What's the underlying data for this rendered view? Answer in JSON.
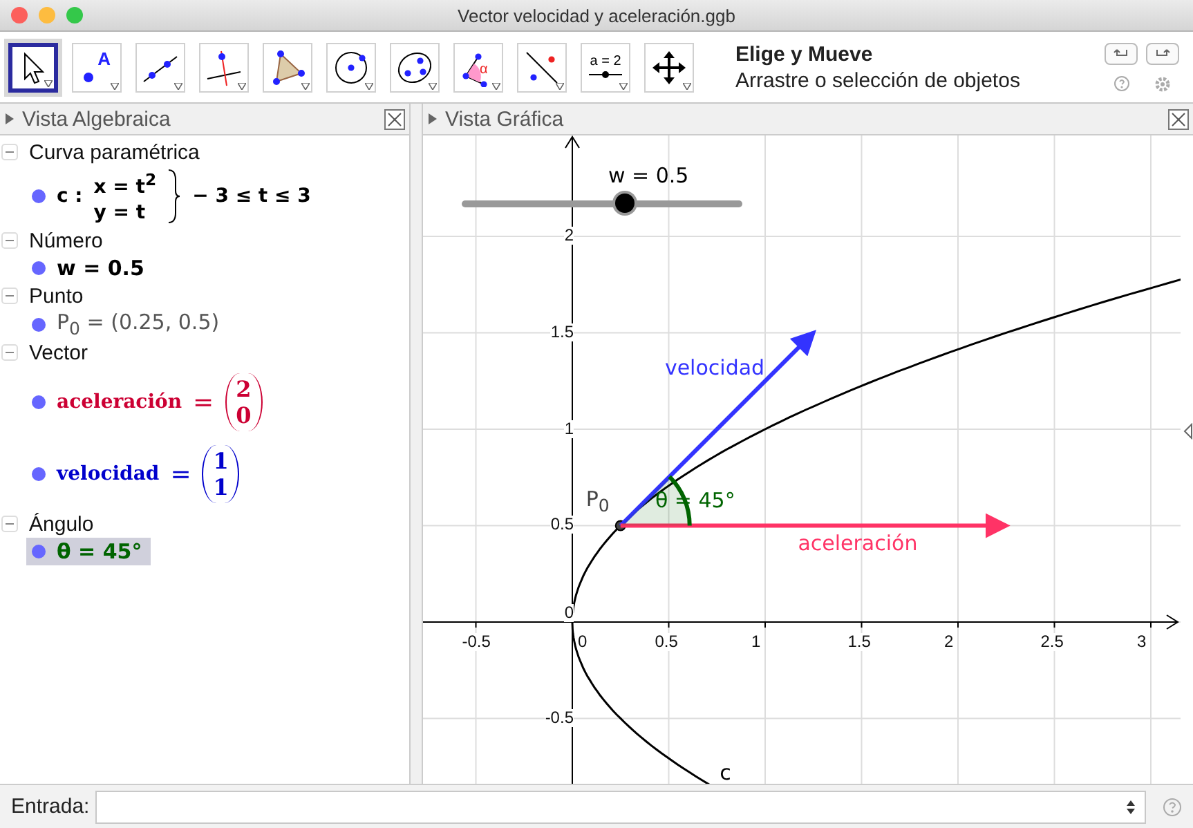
{
  "window": {
    "title": "Vector velocidad y aceleración.ggb"
  },
  "toolbar": {
    "tools": [
      {
        "kind": "move",
        "selected": true
      },
      {
        "kind": "point",
        "selected": false,
        "glyph": "A"
      },
      {
        "kind": "line",
        "selected": false
      },
      {
        "kind": "perpendicular",
        "selected": false
      },
      {
        "kind": "polygon",
        "selected": false
      },
      {
        "kind": "circle",
        "selected": false
      },
      {
        "kind": "conic",
        "selected": false
      },
      {
        "kind": "angle",
        "selected": false,
        "glyph": "α"
      },
      {
        "kind": "reflect",
        "selected": false
      },
      {
        "kind": "slider",
        "selected": false,
        "glyph": "a = 2"
      },
      {
        "kind": "move_view",
        "selected": false
      }
    ],
    "tool_name": "Elige y Mueve",
    "tool_help": "Arrastre o selección de objetos"
  },
  "algebra_view": {
    "title": "Vista Algebraica",
    "categories": [
      {
        "name": "Curva paramétrica",
        "expanded": true,
        "items": [
          {
            "kind": "curve",
            "label": "c :",
            "lines": [
              "x = t$^{2}$",
              "y = t"
            ],
            "range": "− 3 ≤ t ≤ 3",
            "color": "#000000",
            "selected": false
          }
        ]
      },
      {
        "name": "Número",
        "expanded": true,
        "items": [
          {
            "kind": "expression",
            "text": "w = 0.5",
            "bold": true,
            "color": "#000000",
            "selected": false
          }
        ]
      },
      {
        "name": "Punto",
        "expanded": true,
        "items": [
          {
            "kind": "expression",
            "text": "P$_{0}$ = (0.25, 0.5)",
            "bold": false,
            "color": "#555555",
            "selected": false
          }
        ]
      },
      {
        "name": "Vector",
        "expanded": true,
        "items": [
          {
            "kind": "vector",
            "name": "aceleración",
            "sign": "=",
            "components": [
              "2",
              "0"
            ],
            "color": "#cc0033",
            "selected": false
          },
          {
            "kind": "vector",
            "name": "velocidad",
            "sign": "=",
            "components": [
              "1",
              "1"
            ],
            "color": "#0000cc",
            "selected": false
          }
        ]
      },
      {
        "name": "Ángulo",
        "expanded": true,
        "items": [
          {
            "kind": "expression",
            "text": "θ = 45°",
            "bold": true,
            "color": "#006400",
            "selected": true
          }
        ]
      }
    ]
  },
  "graphics_view": {
    "title": "Vista Gráfica",
    "slider": {
      "label": "w = 0.5",
      "level": 0.58
    },
    "x_tick_labels": [
      "-0.5",
      "0",
      "0.5",
      "1",
      "1.5",
      "2",
      "2.5",
      "3"
    ],
    "y_tick_labels": [
      "2",
      "1.5",
      "1",
      "0.5",
      "0",
      "-0.5"
    ],
    "objects": [
      {
        "kind": "curve",
        "label": "c"
      },
      {
        "kind": "point",
        "label": "P$_{0}$"
      },
      {
        "kind": "vector",
        "label": "velocidad",
        "color": "#3333ff"
      },
      {
        "kind": "vector",
        "label": "aceleración",
        "color": "#ff3366"
      },
      {
        "kind": "angle",
        "label": "θ = 45°",
        "color": "#006400"
      }
    ]
  },
  "input_bar": {
    "label": "Entrada:"
  }
}
